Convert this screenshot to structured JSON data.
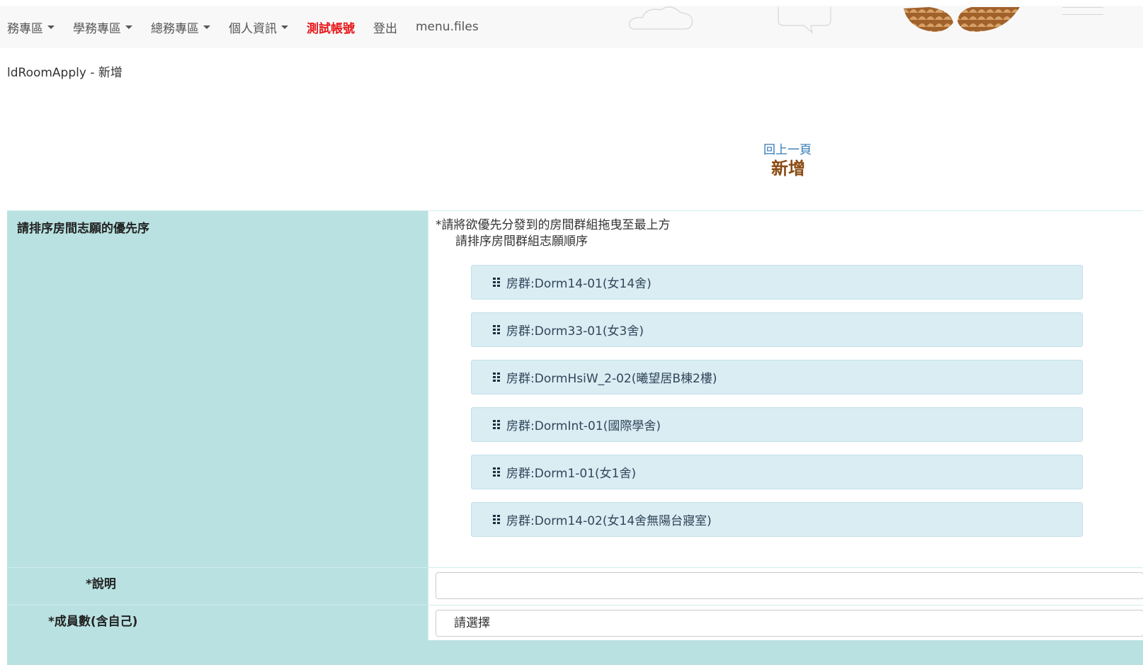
{
  "nav": {
    "items": [
      {
        "label": "務專區",
        "dropdown": true
      },
      {
        "label": "學務專區",
        "dropdown": true
      },
      {
        "label": "總務專區",
        "dropdown": true
      },
      {
        "label": "個人資訊",
        "dropdown": true
      },
      {
        "label": "測試帳號",
        "dropdown": false
      },
      {
        "label": "登出",
        "dropdown": false
      },
      {
        "label": "menu.files",
        "dropdown": false
      }
    ]
  },
  "breadcrumb": "ldRoomApply - 新增",
  "back_link": "回上一頁",
  "page_title": "新增",
  "form": {
    "preference_label": "請排序房間志願的優先序",
    "instruction_main": "*請將欲優先分發到的房間群組拖曳至最上方",
    "instruction_sub": "請排序房間群組志願順序",
    "room_groups": [
      "房群:Dorm14-01(女14舍)",
      "房群:Dorm33-01(女3舍)",
      "房群:DormHsiW_2-02(曦望居B棟2樓)",
      "房群:DormInt-01(國際學舍)",
      "房群:Dorm1-01(女1舍)",
      "房群:Dorm14-02(女14舍無陽台寢室)"
    ],
    "description_label": "*說明",
    "description_value": "",
    "member_count_label": "*成員數(含自己)",
    "member_count_selected": "請選擇"
  },
  "colors": {
    "label_bg": "#b9e1e1",
    "item_bg": "#d9edf3",
    "title": "#8a4b12",
    "link": "#337ab7",
    "highlight_nav": "#e8181b"
  }
}
